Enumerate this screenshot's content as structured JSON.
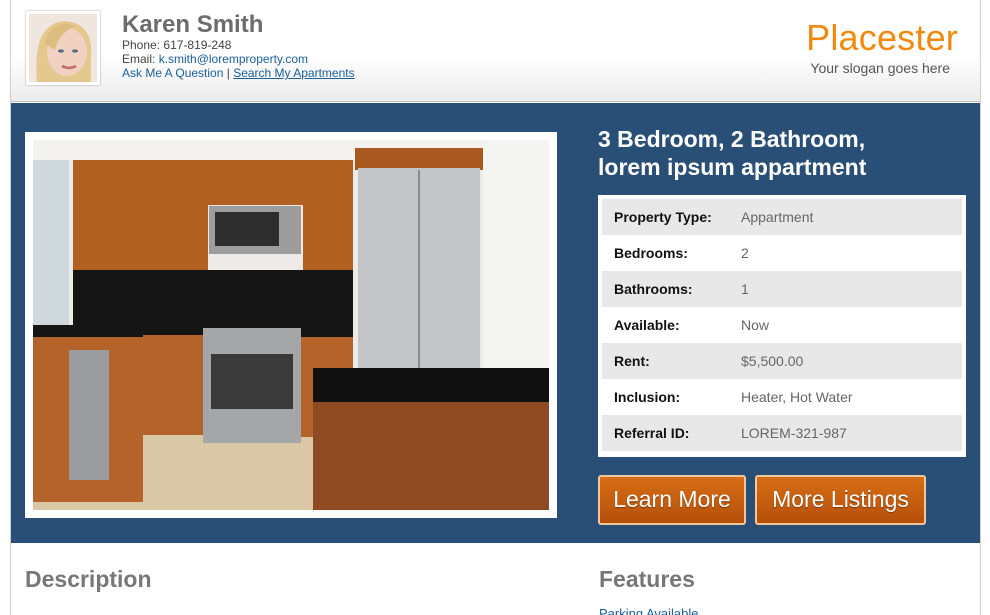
{
  "agent": {
    "name": "Karen Smith",
    "phone_label": "Phone:",
    "phone": "617-819-248",
    "email_label": "Email:",
    "email": "k.smith@loremproperty.com",
    "ask_link": "Ask Me A Question",
    "separator": "|",
    "search_link": "Search My Apartments"
  },
  "brand": {
    "name": "Placester",
    "slogan": "Your slogan goes here",
    "accent_color": "#f08a0f"
  },
  "listing": {
    "title_line1": "3 Bedroom, 2 Bathroom,",
    "title_line2": "lorem ipsum appartment",
    "details": [
      {
        "key": "Property Type:",
        "value": "Appartment"
      },
      {
        "key": "Bedrooms:",
        "value": "2"
      },
      {
        "key": "Bathrooms:",
        "value": "1"
      },
      {
        "key": "Available:",
        "value": "Now"
      },
      {
        "key": "Rent:",
        "value": "$5,500.00"
      },
      {
        "key": "Inclusion:",
        "value": "Heater, Hot Water"
      },
      {
        "key": "Referral ID:",
        "value": "LOREM-321-987"
      }
    ]
  },
  "buttons": {
    "learn_more": "Learn More",
    "more_listings": "More Listings"
  },
  "sections": {
    "description": "Description",
    "features": "Features",
    "features_first_item": "Parking Available"
  },
  "colors": {
    "hero_bg": "#2a4f76",
    "button_orange": "#c85f10",
    "link_blue": "#1a5e9a"
  }
}
